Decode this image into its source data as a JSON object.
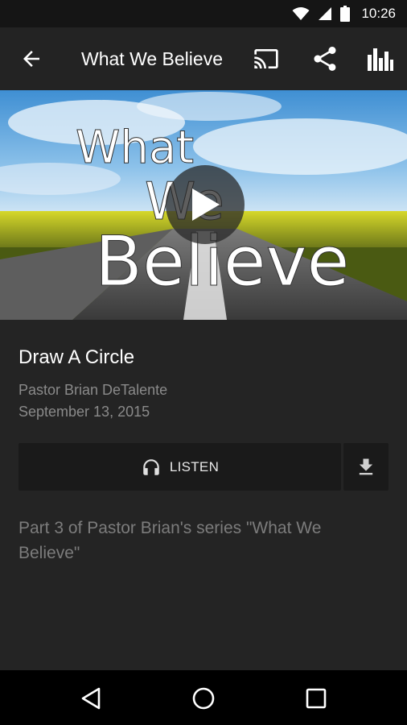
{
  "status_bar": {
    "time": "10:26",
    "icons": [
      "wifi-icon",
      "signal-icon",
      "battery-icon"
    ]
  },
  "app_bar": {
    "title": "What We Believe",
    "actions": [
      "cast-icon",
      "share-icon",
      "stats-icon"
    ]
  },
  "hero": {
    "title_line1": "What",
    "title_line2": "We",
    "title_line3": "Believe",
    "play_icon": "play-icon"
  },
  "sermon": {
    "title": "Draw A Circle",
    "speaker": "Pastor Brian DeTalente",
    "date": "September 13, 2015",
    "listen_label": "LISTEN",
    "description": "Part 3 of Pastor Brian's series \"What We Believe\""
  },
  "nav_bar": {
    "buttons": [
      "back-nav-icon",
      "home-nav-icon",
      "recents-nav-icon"
    ]
  },
  "colors": {
    "background": "#242424",
    "app_bar": "#232323",
    "status_bar": "#151515",
    "button_bg": "#1a1a1a",
    "secondary_text": "#8a8a8a"
  }
}
